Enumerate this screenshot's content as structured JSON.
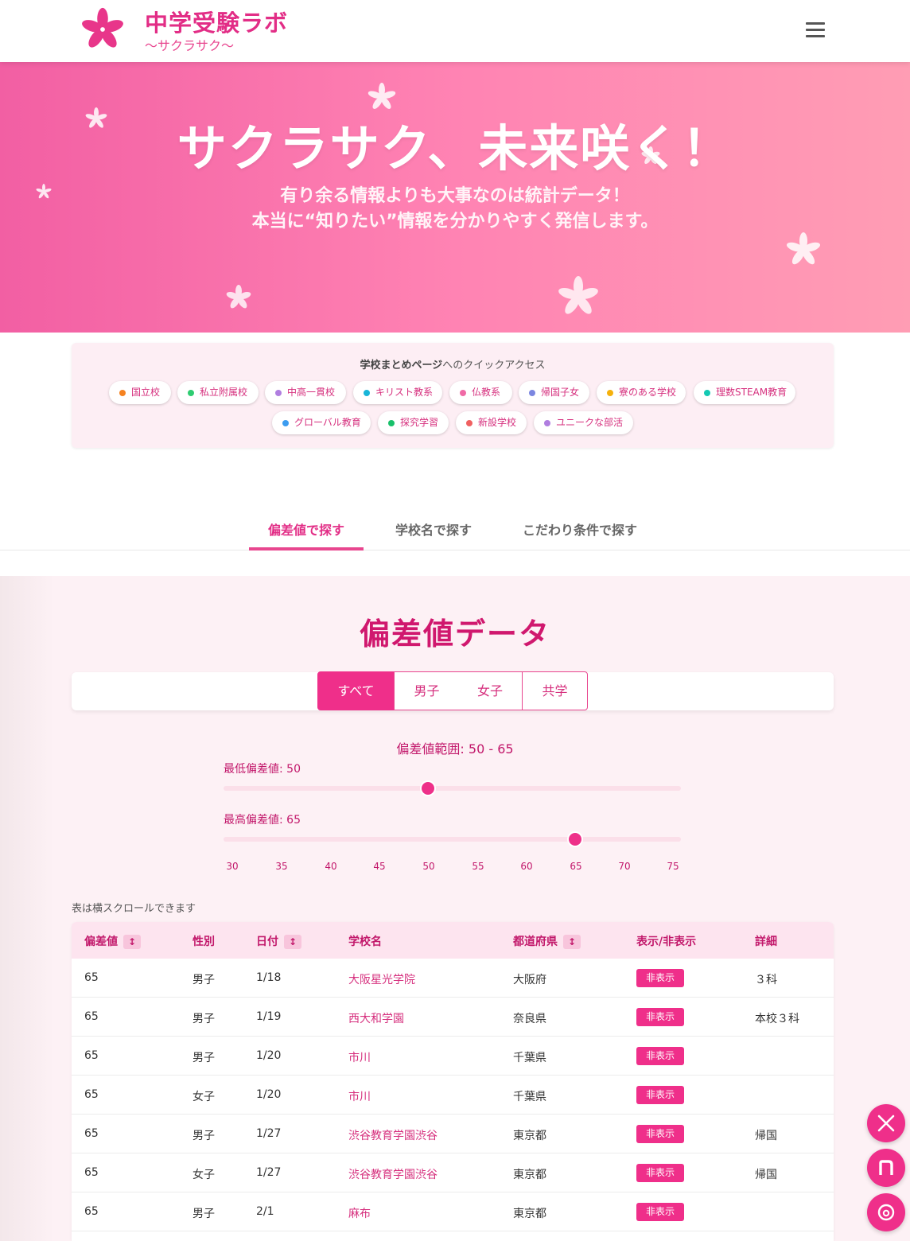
{
  "header": {
    "title": "中学受験ラボ",
    "subtitle": "〜サクラサク〜"
  },
  "hero": {
    "title": "サクラサク、未来咲く！",
    "line1": "有り余る情報よりも大事なのは統計データ！",
    "line2": "本当に“知りたい”情報を分かりやすく発信します。"
  },
  "quick_access": {
    "title_bold": "学校まとめページ",
    "title_rest": "へのクイックアクセス",
    "tags": [
      {
        "label": "国立校",
        "color": "#f58220"
      },
      {
        "label": "私立附属校",
        "color": "#2ecc71"
      },
      {
        "label": "中高一貫校",
        "color": "#b07ee0"
      },
      {
        "label": "キリスト教系",
        "color": "#18b5d8"
      },
      {
        "label": "仏教系",
        "color": "#f06aa6"
      },
      {
        "label": "帰国子女",
        "color": "#7b86e0"
      },
      {
        "label": "寮のある学校",
        "color": "#f5b10c"
      },
      {
        "label": "理数STEAM教育",
        "color": "#14c9b3"
      },
      {
        "label": "グローバル教育",
        "color": "#3b9cf0"
      },
      {
        "label": "探究学習",
        "color": "#18c06a"
      },
      {
        "label": "新設学校",
        "color": "#f06060"
      },
      {
        "label": "ユニークな部活",
        "color": "#b07ee0"
      }
    ]
  },
  "search_tabs": [
    "偏差値で探す",
    "学校名で探す",
    "こだわり条件で探す"
  ],
  "data_section": {
    "title": "偏差値データ",
    "filters": [
      "すべて",
      "男子",
      "女子",
      "共学"
    ],
    "range_title": "偏差値範囲: 50 - 65",
    "min_label": "最低偏差値: 50",
    "max_label": "最高偏差値: 65",
    "min_value": 50,
    "max_value": 65,
    "scale_min": 30,
    "scale_max": 75,
    "ticks": [
      "30",
      "35",
      "40",
      "45",
      "50",
      "55",
      "60",
      "65",
      "70",
      "75"
    ],
    "scroll_note": "表は横スクロールできます"
  },
  "table": {
    "headers": {
      "hensachi": "偏差値",
      "gender": "性別",
      "date": "日付",
      "school": "学校名",
      "pref": "都道府県",
      "toggle": "表示/非表示",
      "detail": "詳細"
    },
    "sort_icon": "↕",
    "hide_label": "非表示",
    "rows": [
      {
        "hensachi": "65",
        "gender": "男子",
        "date": "1/18",
        "school": "大阪星光学院",
        "pref": "大阪府",
        "detail": "３科"
      },
      {
        "hensachi": "65",
        "gender": "男子",
        "date": "1/19",
        "school": "西大和学園",
        "pref": "奈良県",
        "detail": "本校３科"
      },
      {
        "hensachi": "65",
        "gender": "男子",
        "date": "1/20",
        "school": "市川",
        "pref": "千葉県",
        "detail": ""
      },
      {
        "hensachi": "65",
        "gender": "女子",
        "date": "1/20",
        "school": "市川",
        "pref": "千葉県",
        "detail": ""
      },
      {
        "hensachi": "65",
        "gender": "男子",
        "date": "1/27",
        "school": "渋谷教育学園渋谷",
        "pref": "東京都",
        "detail": "帰国"
      },
      {
        "hensachi": "65",
        "gender": "女子",
        "date": "1/27",
        "school": "渋谷教育学園渋谷",
        "pref": "東京都",
        "detail": "帰国"
      },
      {
        "hensachi": "65",
        "gender": "男子",
        "date": "2/1",
        "school": "麻布",
        "pref": "東京都",
        "detail": ""
      }
    ]
  },
  "social": [
    "x-icon",
    "note-icon",
    "threads-icon"
  ],
  "colors": {
    "brand": "#e22d86",
    "accent": "#ef2f8a"
  }
}
